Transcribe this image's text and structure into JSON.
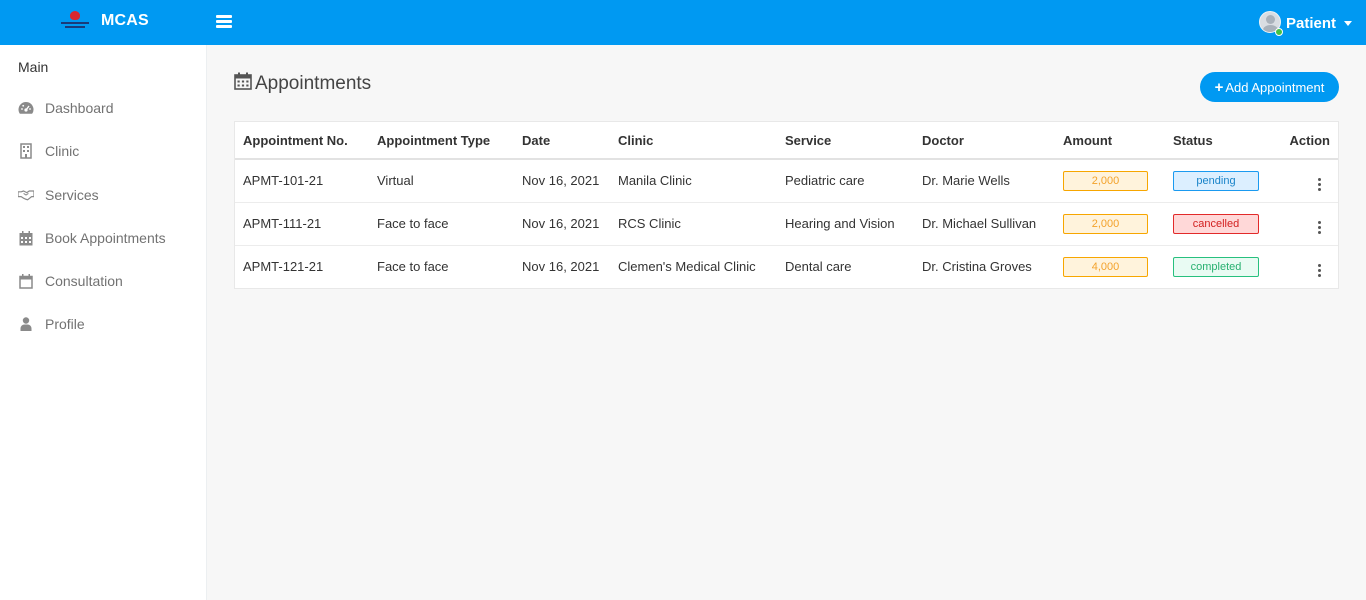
{
  "app": {
    "brand_name": "MCAS",
    "user_name": "Patient"
  },
  "sidebar": {
    "section_title": "Main",
    "items": [
      {
        "label": "Dashboard",
        "icon": "dashboard-icon"
      },
      {
        "label": "Clinic",
        "icon": "building-icon"
      },
      {
        "label": "Services",
        "icon": "handshake-icon"
      },
      {
        "label": "Book Appointments",
        "icon": "calendar-grid-icon"
      },
      {
        "label": "Consultation",
        "icon": "calendar-icon"
      },
      {
        "label": "Profile",
        "icon": "user-icon"
      }
    ]
  },
  "main": {
    "title": "Appointments",
    "add_button_label": "Add Appointment",
    "table": {
      "columns": [
        "Appointment No.",
        "Appointment Type",
        "Date",
        "Clinic",
        "Service",
        "Doctor",
        "Amount",
        "Status",
        "Action"
      ],
      "rows": [
        {
          "no": "APMT-101-21",
          "type": "Virtual",
          "date": "Nov 16, 2021",
          "clinic": "Manila Clinic",
          "service": "Pediatric care",
          "doctor": "Dr. Marie Wells",
          "amount": "2,000",
          "status": "pending"
        },
        {
          "no": "APMT-111-21",
          "type": "Face to face",
          "date": "Nov 16, 2021",
          "clinic": "RCS Clinic",
          "service": "Hearing and Vision",
          "doctor": "Dr. Michael Sullivan",
          "amount": "2,000",
          "status": "cancelled"
        },
        {
          "no": "APMT-121-21",
          "type": "Face to face",
          "date": "Nov 16, 2021",
          "clinic": "Clemen's Medical Clinic",
          "service": "Dental care",
          "doctor": "Dr. Cristina Groves",
          "amount": "4,000",
          "status": "completed"
        }
      ]
    }
  },
  "colors": {
    "primary": "#0099f2",
    "pending": "#1a9af0",
    "cancelled": "#e22a2a",
    "completed": "#27c07e",
    "amount": "#f7a600"
  }
}
